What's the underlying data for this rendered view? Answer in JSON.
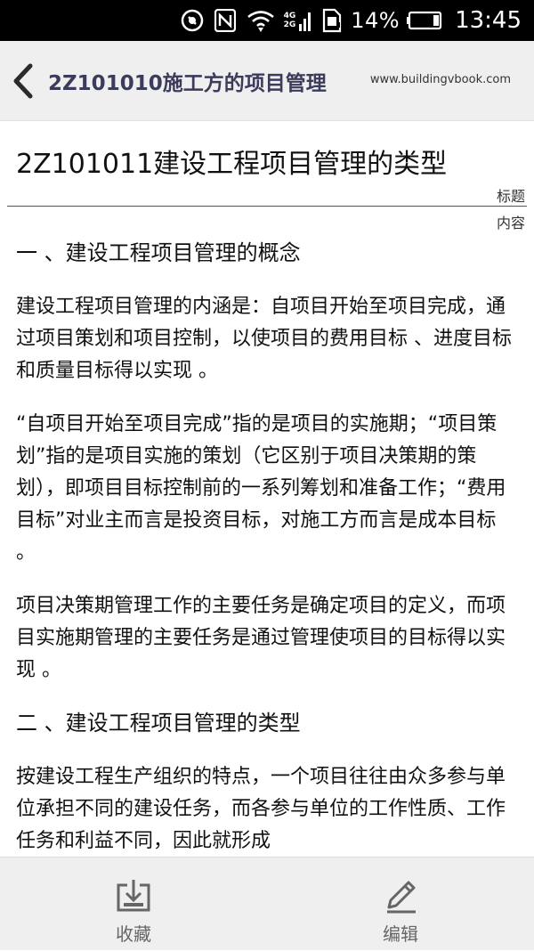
{
  "status_bar": {
    "net_top": "4G",
    "net_bottom": "2G",
    "battery_percent": "14%",
    "time": "13:45",
    "icons": [
      "vibrate-icon",
      "nfc-icon",
      "wifi-icon",
      "signal-icon",
      "sim-alert-icon",
      "battery-icon"
    ]
  },
  "header": {
    "title": "2Z101010施工方的项目管理",
    "site": "www.buildingvbook.com",
    "back_icon": "chevron-left-icon"
  },
  "document": {
    "title": "2Z101011建设工程项目管理的类型",
    "tag_title": "标题",
    "tag_content": "内容",
    "heading1": "一 、建设工程项目管理的概念",
    "p1": "建设工程项目管理的内涵是：自项目开始至项目完成，通过项目策划和项目控制，以使项目的费用目标 、进度目标和质量目标得以实现 。",
    "p2": "“自项目开始至项目完成”指的是项目的实施期；“项目策划”指的是项目实施的策划（它区别于项目决策期的策划），即项目目标控制前的一系列筹划和准备工作；“费用目标”对业主而言是投资目标，对施工方而言是成本目标 。",
    "p3": "项目决策期管理工作的主要任务是确定项目的定义，而项目实施期管理的主要任务是通过管理使项目的目标得以实现 。",
    "heading2": "二 、建设工程项目管理的类型",
    "p4": "按建设工程生产组织的特点，一个项目往往由众多参与单位承担不同的建设任务，而各参与单位的工作性质、工作任务和利益不同，因此就形成"
  },
  "bottom_bar": {
    "favorite_label": "收藏",
    "edit_label": "编辑",
    "favorite_icon": "download-tray-icon",
    "edit_icon": "pencil-icon"
  },
  "colors": {
    "status_bg": "#000000",
    "header_bg": "#efefef",
    "header_title": "#3b3b5c",
    "bottom_bg": "#efefef"
  }
}
